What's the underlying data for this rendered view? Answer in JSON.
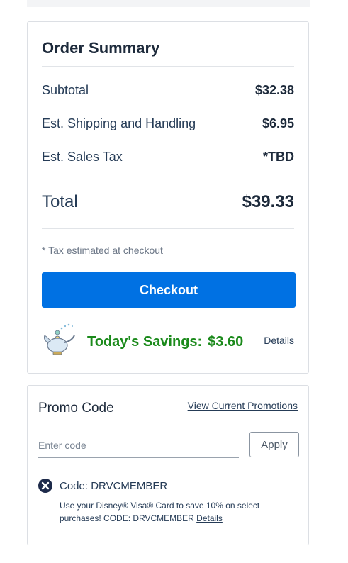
{
  "order_summary": {
    "title": "Order Summary",
    "subtotal_label": "Subtotal",
    "subtotal_value": "$32.38",
    "shipping_label": "Est. Shipping and Handling",
    "shipping_value": "$6.95",
    "tax_label": "Est. Sales Tax",
    "tax_value": "*TBD",
    "total_label": "Total",
    "total_value": "$39.33",
    "tax_note": "* Tax estimated at checkout",
    "checkout_label": "Checkout",
    "savings_label": "Today's Savings:",
    "savings_value": "$3.60",
    "details_label": "Details"
  },
  "promo": {
    "title": "Promo Code",
    "view_promotions_label": "View Current Promotions",
    "input_placeholder": "Enter code",
    "input_value": "",
    "apply_label": "Apply",
    "applied_code_label": "Code: DRVCMEMBER",
    "applied_code_description": "Use your Disney® Visa® Card to save 10% on select purchases! CODE: DRVCMEMBER",
    "details_label": "Details"
  },
  "colors": {
    "primary": "#0071e3",
    "savings": "#1b8a1b",
    "text": "#253b56",
    "remove_icon": "#1d2a4a"
  },
  "icons": {
    "savings": "magic-lamp-icon",
    "remove_code": "remove-circle-x-icon"
  }
}
